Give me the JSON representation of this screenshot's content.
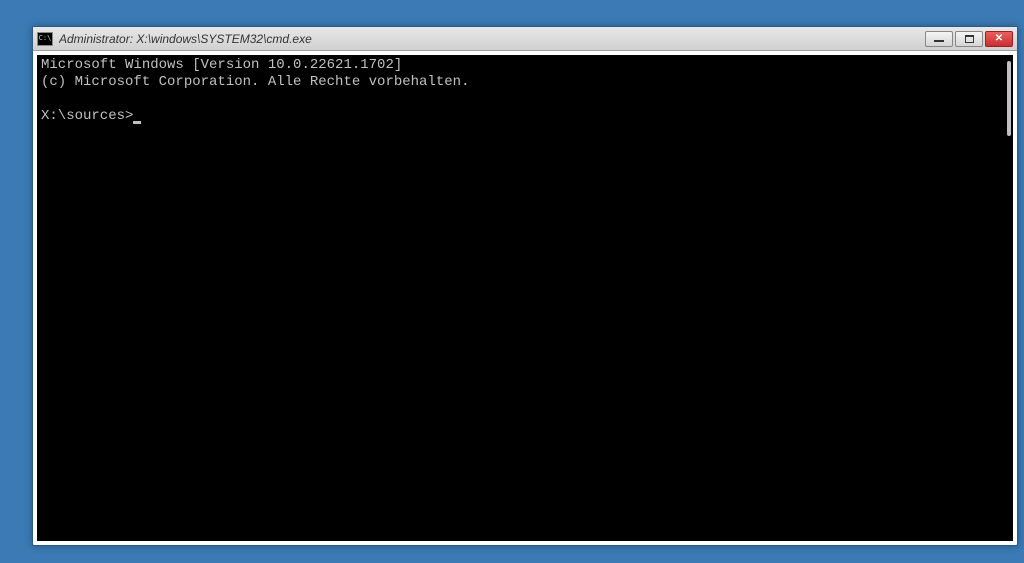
{
  "window": {
    "title": "Administrator: X:\\windows\\SYSTEM32\\cmd.exe",
    "icon_label": "C:\\"
  },
  "console": {
    "line1": "Microsoft Windows [Version 10.0.22621.1702]",
    "line2": "(c) Microsoft Corporation. Alle Rechte vorbehalten.",
    "blank": "",
    "prompt": "X:\\sources>"
  }
}
